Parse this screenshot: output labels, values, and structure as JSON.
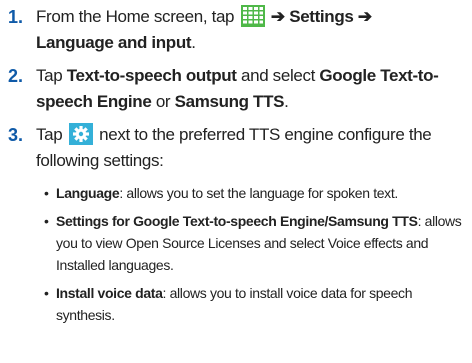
{
  "steps": [
    {
      "number": "1.",
      "text_1": "From the Home screen, tap",
      "icon": "apps-grid-icon",
      "arrow_1": "➔",
      "settings": "Settings",
      "arrow_2": "➔",
      "language_input": "Language and input",
      "end": "."
    },
    {
      "number": "2.",
      "text_1": "Tap",
      "tts_output": "Text-to-speech output",
      "text_2": "and select",
      "google_engine": "Google Text-to-speech Engine",
      "text_3": "or",
      "samsung_tts": "Samsung TTS",
      "end": "."
    },
    {
      "number": "3.",
      "text_1": "Tap",
      "icon": "gear-icon",
      "text_2": "next to the preferred TTS engine configure the following settings:"
    }
  ],
  "bullets": [
    {
      "marker": "•",
      "term": "Language",
      "desc": ": allows you to set the language for spoken text."
    },
    {
      "marker": "•",
      "term": "Settings for Google Text-to-speech Engine/Samsung TTS",
      "desc": ": allows you to view Open Source Licenses and select Voice effects and Installed languages."
    },
    {
      "marker": "•",
      "term": "Install voice data",
      "desc": ": allows you to install voice data for speech synthesis."
    }
  ],
  "colors": {
    "number": "#0f5aa8",
    "text": "#222222",
    "apps_icon_bg": "#4fb848",
    "gear_icon_bg": "#34b0d8"
  }
}
